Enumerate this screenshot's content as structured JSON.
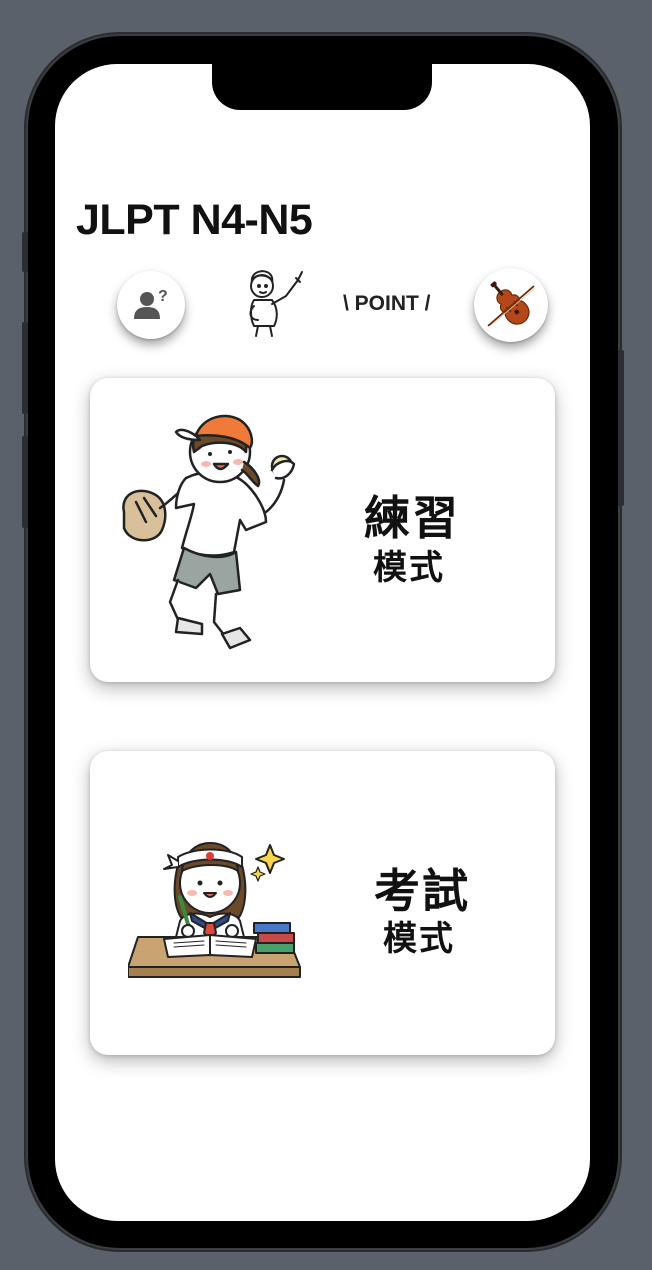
{
  "app": {
    "title": "JLPT N4-N5"
  },
  "header": {
    "profile_icon": "user-question-icon",
    "mascot_icon": "pointing-boy-illustration",
    "point_label": "\\ POINT /",
    "music_icon": "violin-icon"
  },
  "cards": [
    {
      "main": "練習",
      "sub": "模式",
      "illustration": "baseball-girl-illustration"
    },
    {
      "main": "考試",
      "sub": "模式",
      "illustration": "studying-student-illustration"
    }
  ],
  "colors": {
    "background": "#5b616a",
    "screen": "#ffffff",
    "cap_orange": "#f07a3a",
    "violin": "#b5481a"
  }
}
